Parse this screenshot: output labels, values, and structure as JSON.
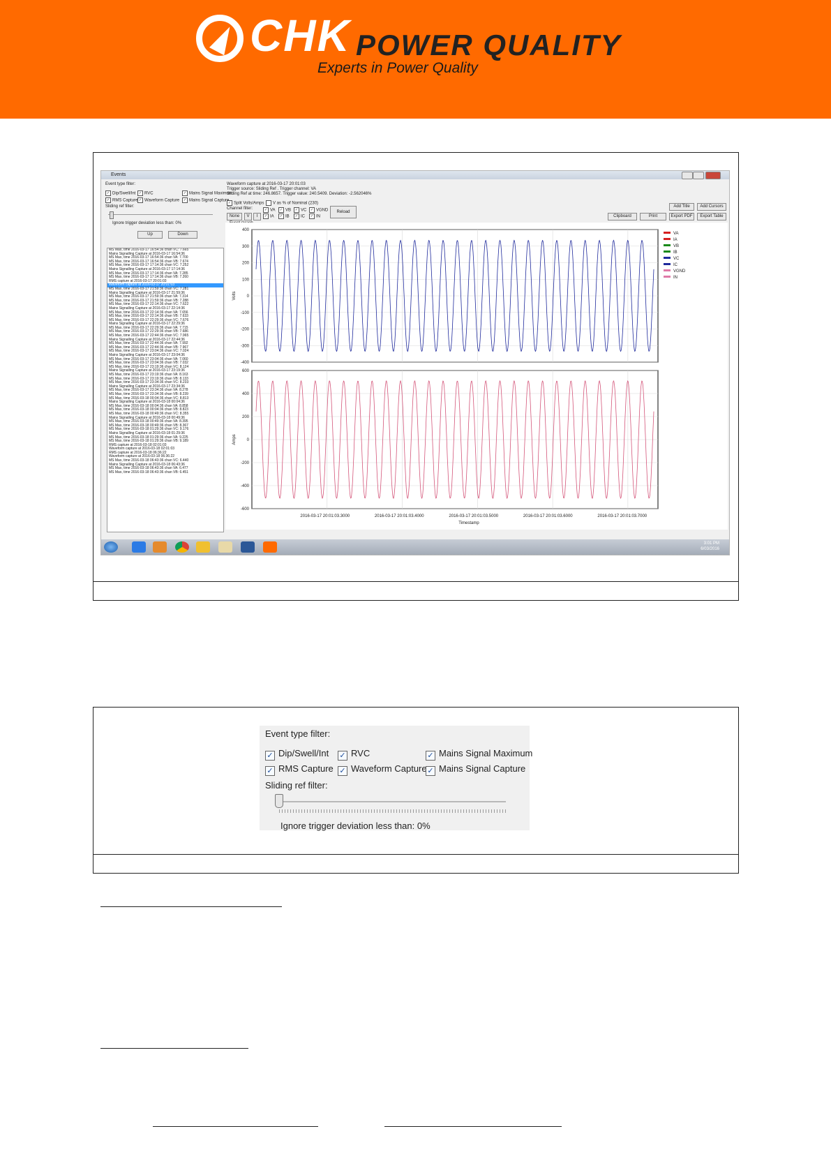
{
  "banner": {
    "logo_main": "CHK",
    "logo_sub": "POWER QUALITY",
    "tagline": "Experts in Power Quality",
    "color": "#ff6a00"
  },
  "screenshot1": {
    "window_title": "Events",
    "event_type_filter_label": "Event type filter:",
    "filters": [
      "Dip/Swell/Int",
      "RVC",
      "Mains Signal Maximum",
      "RMS Capture",
      "Waveform Capture",
      "Mains Signal Capture"
    ],
    "sliding_ref_label": "Sliding ref filter:",
    "ignore_label": "Ignore trigger deviation less than: 0%",
    "up_label": "Up",
    "down_label": "Down",
    "info_lines": [
      "Waveform capture at 2016-03-17 20:01:03",
      "Trigger source: Sliding Ref . Trigger channel: VA",
      "Sliding Ref at time: 246.8657. Trigger value: 240.5409. Deviation: -2.562046%"
    ],
    "split_label": "Split Volts/Amps",
    "v_nominal_label": "V as % of Nominal (230)",
    "channel_filter_label": "Channel filter:",
    "none_label": "None",
    "v_label": "V",
    "i_label": "I",
    "channels": [
      "VA",
      "VB",
      "VC",
      "VGND",
      "IA",
      "IB",
      "IC",
      "IN"
    ],
    "reload_label": "Reload",
    "add_title_label": "Add Title",
    "add_cursors_label": "Add Cursors",
    "clipboard_label": "Clipboard",
    "print_label": "Print",
    "export_pdf_label": "Export PDF",
    "export_table_label": "Export Table",
    "event_graph_label": "Event Graph",
    "events": [
      "MS Max, time 2016-03-17 16:54:36 chan VC: 7.665",
      "Mains Signalling Capture at 2016-03-17 16:54:36",
      "MS Max, time 2016-03-17 16:54:36 chan VA: 7.700",
      "MS Max, time 2016-03-17 16:54:36 chan VB: 7.674",
      "MS Max, time 2016-03-17 17:14:36 chan VC: 7.252",
      "Mains Signalling Capture at 2016-03-17 17:14:36",
      "MS Max, time 2016-03-17 17:14:36 chan VA: 7.285",
      "MS Max, time 2016-03-17 17:14:36 chan VB: 7.260",
      "RMS capture at 2016-03-17 20:01:03",
      "Waveform capture at 2016-03-17 20:01:03",
      "MS Max, time 2016-03-17 21:59:36 chan VC: 7.281",
      "Mains Signalling Capture at 2016-03-17 21:59:36",
      "MS Max, time 2016-03-17 21:59:36 chan VA: 7.314",
      "MS Max, time 2016-03-17 21:59:36 chan VB: 7.288",
      "MS Max, time 2016-03-17 22:14:36 chan VC: 7.622",
      "Mains Signalling Capture at 2016-03-17 22:14:36",
      "MS Max, time 2016-03-17 22:14:36 chan VA: 7.656",
      "MS Max, time 2016-03-17 22:14:36 chan VB: 7.633",
      "MS Max, time 2016-03-17 22:29:36 chan VC: 7.676",
      "Mains Signalling Capture at 2016-03-17 22:29:36",
      "MS Max, time 2016-03-17 22:29:36 chan VA: 7.715",
      "MS Max, time 2016-03-17 22:29:36 chan VB: 7.686",
      "MS Max, time 2016-03-17 22:44:36 chan VC: 7.965",
      "Mains Signalling Capture at 2016-03-17 22:44:36",
      "MS Max, time 2016-03-17 22:44:36 chan VA: 7.992",
      "MS Max, time 2016-03-17 22:44:36 chan VB: 7.967",
      "MS Max, time 2016-03-17 23:04:36 chan VC: 7.024",
      "Mains Signalling Capture at 2016-03-17 23:04:36",
      "MS Max, time 2016-03-17 23:04:36 chan VA: 7.060",
      "MS Max, time 2016-03-17 23:04:36 chan VB: 7.032",
      "MS Max, time 2016-03-17 23:19:36 chan VC: 8.124",
      "Mains Signalling Capture at 2016-03-17 23:19:36",
      "MS Max, time 2016-03-17 23:19:36 chan VA: 8.163",
      "MS Max, time 2016-03-17 23:19:36 chan VB: 8.133",
      "MS Max, time 2016-03-17 23:34:36 chan VC: 8.233",
      "Mains Signalling Capture at 2016-03-17 23:34:36",
      "MS Max, time 2016-03-17 23:34:36 chan VA: 8.278",
      "MS Max, time 2016-03-17 23:34:36 chan VB: 8.239",
      "MS Max, time 2016-03-18 00:04:36 chan VC: 8.813",
      "Mains Signalling Capture at 2016-03-18 00:04:36",
      "MS Max, time 2016-03-18 00:04:36 chan VA: 8.858",
      "MS Max, time 2016-03-18 00:04:36 chan VB: 8.823",
      "MS Max, time 2016-03-18 00:49:36 chan VC: 8.355",
      "Mains Signalling Capture at 2016-03-18 00:49:36",
      "MS Max, time 2016-03-18 00:49:36 chan VA: 8.395",
      "MS Max, time 2016-03-18 00:49:36 chan VB: 8.367",
      "MS Max, time 2016-03-18 01:29:36 chan VC: 9.176",
      "Mains Signalling Capture at 2016-03-18 01:29:36",
      "MS Max, time 2016-03-18 01:29:36 chan VA: 9.225",
      "MS Max, time 2016-03-18 01:29:36 chan VB: 9.189",
      "RMS capture at 2016-03-18 02:01:03",
      "Waveform capture at 2016-03-18 02:01:03",
      "RMS capture at 2016-03-18 06:36:22",
      "Waveform capture at 2016-03-18 06:36:22",
      "MS Max, time 2016-03-18 06:43:36 chan VC: 6.440",
      "Mains Signalling Capture at 2016-03-18 06:43:36",
      "MS Max, time 2016-03-18 06:43:36 chan VA: 6.477",
      "MS Max, time 2016-03-18 06:43:36 chan VB: 6.451"
    ],
    "selected_index": 9,
    "clock_time": "3:01 PM",
    "clock_date": "6/03/2016"
  },
  "chart_data": {
    "type": "line",
    "xlabel": "Timestamp",
    "x_ticks": [
      "2016-03-17 20:01:03.3000",
      "2016-03-17 20:01:03.4000",
      "2016-03-17 20:01:03.5000",
      "2016-03-17 20:01:03.6000",
      "2016-03-17 20:01:03.7000"
    ],
    "legend": [
      "VA",
      "IA",
      "VB",
      "IB",
      "VC",
      "IC",
      "VGND",
      "IN"
    ],
    "legend_colors": [
      "#d62020",
      "#d62020",
      "#1a8a1a",
      "#1a8a1a",
      "#1f2a9c",
      "#1f2a9c",
      "#e07aa8",
      "#e07aa8"
    ],
    "legend_placement": "right",
    "grid": true,
    "cycles": 28,
    "panels": [
      {
        "ylabel": "Volts",
        "ylim": [
          -400,
          400
        ],
        "y_ticks": [
          400,
          300,
          200,
          100,
          0,
          -100,
          -200,
          -300,
          -400
        ],
        "series": [
          {
            "color": "#1f2a9c",
            "amplitude": 335
          }
        ]
      },
      {
        "ylabel": "Amps",
        "ylim": [
          -600,
          600
        ],
        "y_ticks": [
          600,
          400,
          200,
          0,
          -200,
          -400,
          -600
        ],
        "series": [
          {
            "color": "#d4567a",
            "amplitude": 510
          }
        ]
      }
    ]
  },
  "screenshot2": {
    "event_type_filter_label": "Event type filter:",
    "filters": [
      "Dip/Swell/Int",
      "RVC",
      "Mains Signal Maximum",
      "RMS Capture",
      "Waveform Capture",
      "Mains Signal Capture"
    ],
    "sliding_ref_label": "Sliding ref filter:",
    "ignore_label": "Ignore trigger deviation less than: 0%"
  }
}
